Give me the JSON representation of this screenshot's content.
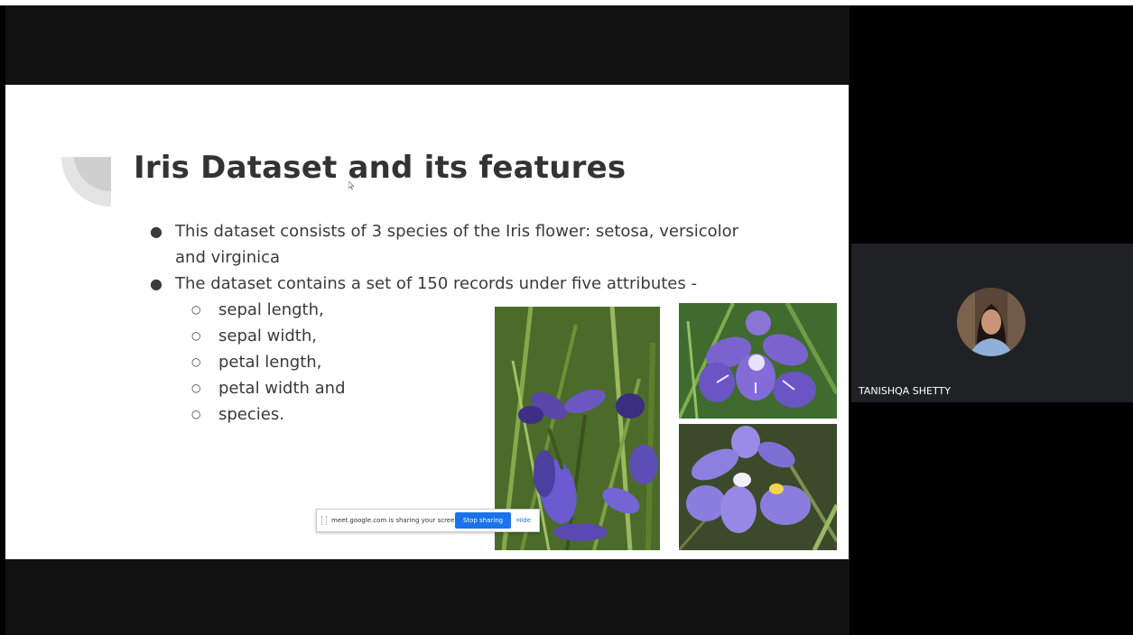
{
  "slide": {
    "title": "Iris Dataset and its features",
    "bullets": [
      "This dataset consists of 3 species of the Iris flower: setosa, versicolor",
      "and virginica",
      "The dataset contains a set of 150 records under five attributes -"
    ],
    "sub_items": [
      "sepal length,",
      "sepal width,",
      "petal length,",
      "petal width and",
      "species."
    ]
  },
  "share_bar": {
    "message": "meet.google.com is sharing your screen.",
    "stop_label": "Stop sharing",
    "hide_label": "Hide"
  },
  "participant": {
    "name": "TANISHQA SHETTY"
  },
  "colors": {
    "background": "#000000",
    "tile": "#202124",
    "stop_button": "#1a73e8",
    "title_text": "#333333",
    "flower_purple": "#7b6fd0"
  },
  "icons": [
    "slide-decoration-icon",
    "mouse-cursor-icon",
    "drag-grip-icon",
    "bullet-dot-icon",
    "bullet-ring-icon"
  ]
}
